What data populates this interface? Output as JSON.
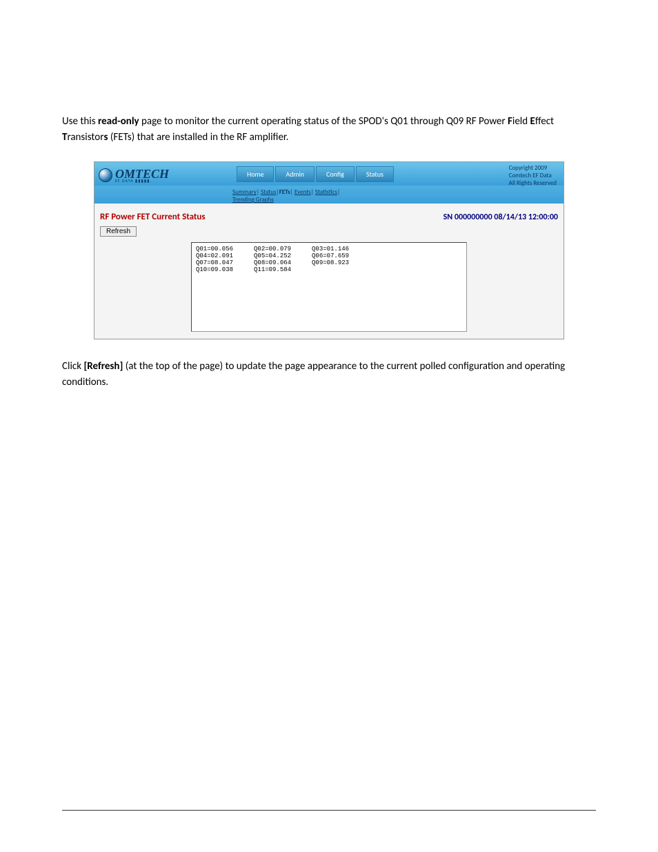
{
  "intro": {
    "prefix": "Use this ",
    "readonly": "read-only",
    "mid1": " page to monitor the current operating status of the SPOD's Q01 through Q09 RF Power ",
    "F": "F",
    "field_suffix": "ield ",
    "E": "E",
    "effect_suffix": "ffect ",
    "T": "T",
    "trans_suffix": "ransistor",
    "s": "s",
    "tail": " (FETs) that are installed in the RF amplifier."
  },
  "logo": {
    "main": "OMTECH",
    "sub": "EF DATA ▮▮▮▮▮."
  },
  "nav": {
    "home": "Home",
    "admin": "Admin",
    "config": "Config",
    "status": "Status"
  },
  "subnav": {
    "summary": "Summary",
    "status": "Status",
    "fets": "FETs",
    "events": "Events",
    "statistics": "Statistics",
    "trending": "Trending Graphs"
  },
  "copyright": {
    "line1": "Copyright 2009",
    "line2": "Comtech EF Data",
    "line3": "All Rights Reserved"
  },
  "content": {
    "title": "RF Power FET Current Status",
    "sn": "SN 000000000 08/14/13 12:00:00",
    "refresh": "Refresh"
  },
  "fets": {
    "r1c1": "Q01=00.056",
    "r1c2": "Q02=00.079",
    "r1c3": "Q03=01.146",
    "r2c1": "Q04=02.091",
    "r2c2": "Q05=04.252",
    "r2c3": "Q06=07.659",
    "r3c1": "Q07=08.047",
    "r3c2": "Q08=09.064",
    "r3c3": "Q09=08.923",
    "r4c1": "Q10=09.038",
    "r4c2": "Q11=09.584"
  },
  "after": {
    "prefix": "Click ",
    "refresh": "[Refresh]",
    "tail": " (at the top of the page) to update the page appearance to the current polled configuration and operating conditions."
  }
}
